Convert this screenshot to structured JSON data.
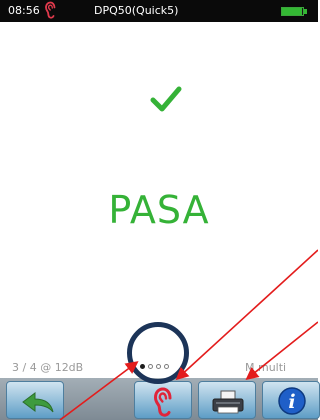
{
  "status_bar": {
    "time": "08:56",
    "title": "DPQ50(Quick5)",
    "ear_icon": "ear-icon",
    "battery_level": 0.95
  },
  "main": {
    "check_icon": "check-icon",
    "result": "PASA"
  },
  "footer": {
    "progress": "3 / 4 @ 12dB",
    "mode_partial": "M",
    "mode": "multi",
    "page_dots": {
      "count": 4,
      "active_index": 0
    }
  },
  "toolbar": {
    "buttons": [
      {
        "icon": "back-arrow-icon"
      },
      {
        "icon": "ear-icon"
      },
      {
        "icon": "printer-icon"
      },
      {
        "icon": "info-icon",
        "label": "i"
      }
    ]
  },
  "colors": {
    "result_green": "#35b237",
    "status_bar_bg": "#0a0a0a",
    "annotation_red": "#e31c1c",
    "highlight_ring": "#1c3458"
  }
}
